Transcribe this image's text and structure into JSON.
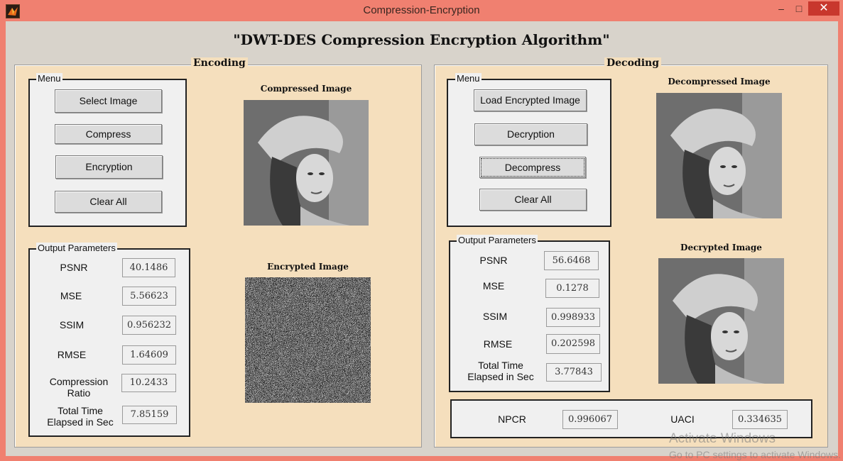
{
  "window": {
    "title": "Compression-Encryption",
    "min_glyph": "–",
    "max_glyph": "□",
    "close_glyph": "✕"
  },
  "heading": "\"DWT-DES Compression Encryption Algorithm\"",
  "encoding": {
    "title": "Encoding",
    "menu_title": "Menu",
    "buttons": {
      "select_image": "Select Image",
      "compress": "Compress",
      "encryption": "Encryption",
      "clear_all": "Clear All"
    },
    "output_title": "Output Parameters",
    "params": {
      "psnr_label": "PSNR",
      "psnr": "40.1486",
      "mse_label": "MSE",
      "mse": "5.56623",
      "ssim_label": "SSIM",
      "ssim": "0.956232",
      "rmse_label": "RMSE",
      "rmse": "1.64609",
      "ratio_label_1": "Compression",
      "ratio_label_2": "Ratio",
      "ratio": "10.2433",
      "time_label_1": "Total Time",
      "time_label_2": "Elapsed in Sec",
      "time": "7.85159"
    },
    "compressed_caption": "Compressed Image",
    "encrypted_caption": "Encrypted Image"
  },
  "decoding": {
    "title": "Decoding",
    "menu_title": "Menu",
    "buttons": {
      "load_encrypted": "Load Encrypted Image",
      "decryption": "Decryption",
      "decompress": "Decompress",
      "clear_all": "Clear All"
    },
    "output_title": "Output Parameters",
    "params": {
      "psnr_label": "PSNR",
      "psnr": "56.6468",
      "mse_label": "MSE",
      "mse": "0.1278",
      "ssim_label": "SSIM",
      "ssim": "0.998933",
      "rmse_label": "RMSE",
      "rmse": "0.202598",
      "time_label_1": "Total Time",
      "time_label_2": "Elapsed in Sec",
      "time": "3.77843"
    },
    "npcr_label": "NPCR",
    "npcr": "0.996067",
    "uaci_label": "UACI",
    "uaci": "0.334635",
    "decompressed_caption": "Decompressed Image",
    "decrypted_caption": "Decrypted Image"
  },
  "watermark": {
    "line1": "Activate Windows",
    "line2": "Go to PC settings to activate Windows."
  },
  "colors": {
    "titlebar": "#f08070",
    "panel": "#f5dfbd",
    "close": "#c8372d"
  }
}
